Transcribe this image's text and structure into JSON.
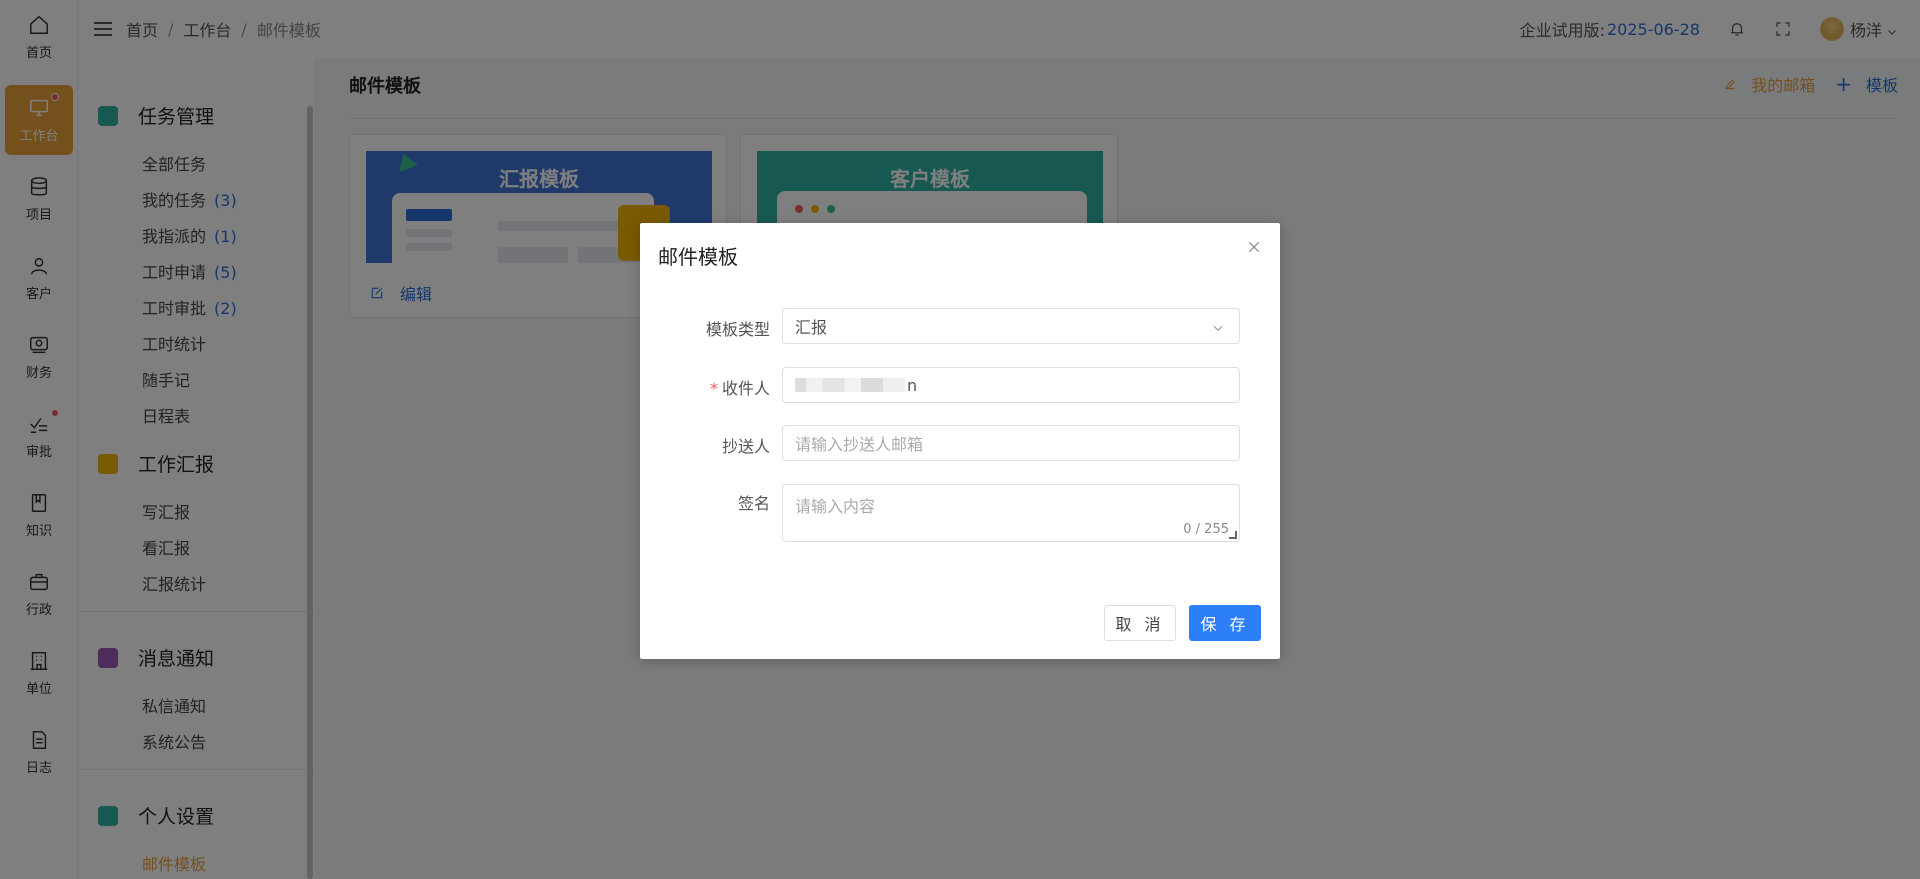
{
  "rail": {
    "items": [
      {
        "label": "首页",
        "icon": "home-icon"
      },
      {
        "label": "工作台",
        "icon": "monitor-icon",
        "active": true
      },
      {
        "label": "项目",
        "icon": "database-icon"
      },
      {
        "label": "客户",
        "icon": "user-icon"
      },
      {
        "label": "财务",
        "icon": "finance-icon"
      },
      {
        "label": "审批",
        "icon": "approve-icon"
      },
      {
        "label": "知识",
        "icon": "book-icon"
      },
      {
        "label": "行政",
        "icon": "briefcase-icon"
      },
      {
        "label": "单位",
        "icon": "building-icon"
      },
      {
        "label": "日志",
        "icon": "log-icon"
      }
    ]
  },
  "topbar": {
    "breadcrumb": [
      "首页",
      "工作台",
      "邮件模板"
    ],
    "trial_label": "企业试用版:",
    "trial_date": "2025-06-28",
    "user_name": "杨洋"
  },
  "sidebar": {
    "groups": [
      {
        "title": "任务管理",
        "color": "#2fb3a3",
        "items": [
          {
            "label": "全部任务",
            "count": ""
          },
          {
            "label": "我的任务",
            "count": "(3)"
          },
          {
            "label": "我指派的",
            "count": "(1)"
          },
          {
            "label": "工时申请",
            "count": "(5)"
          },
          {
            "label": "工时审批",
            "count": "(2)"
          },
          {
            "label": "工时统计",
            "count": ""
          },
          {
            "label": "随手记",
            "count": ""
          },
          {
            "label": "日程表",
            "count": ""
          }
        ]
      },
      {
        "title": "工作汇报",
        "color": "#f4b400",
        "items": [
          {
            "label": "写汇报"
          },
          {
            "label": "看汇报"
          },
          {
            "label": "汇报统计"
          }
        ]
      },
      {
        "title": "消息通知",
        "color": "#9b59b6",
        "items": [
          {
            "label": "私信通知"
          },
          {
            "label": "系统公告"
          }
        ]
      },
      {
        "title": "个人设置",
        "color": "#2fb3a3",
        "items": [
          {
            "label": "邮件模板",
            "active": true
          }
        ]
      }
    ]
  },
  "main": {
    "title": "邮件模板",
    "my_mailbox": "我的邮箱",
    "add_template": "模板",
    "cards": [
      {
        "title": "汇报模板",
        "edit": "编辑",
        "theme": "#3f73d6"
      },
      {
        "title": "客户模板",
        "theme": "#2fb3a3"
      }
    ]
  },
  "modal": {
    "title": "邮件模板",
    "fields": {
      "type_label": "模板类型",
      "type_value": "汇报",
      "recipient_label": "收件人",
      "recipient_value_tail": "n",
      "cc_label": "抄送人",
      "cc_placeholder": "请输入抄送人邮箱",
      "sign_label": "签名",
      "sign_placeholder": "请输入内容",
      "sign_counter": "0 / 255"
    },
    "cancel": "取 消",
    "save": "保 存"
  }
}
